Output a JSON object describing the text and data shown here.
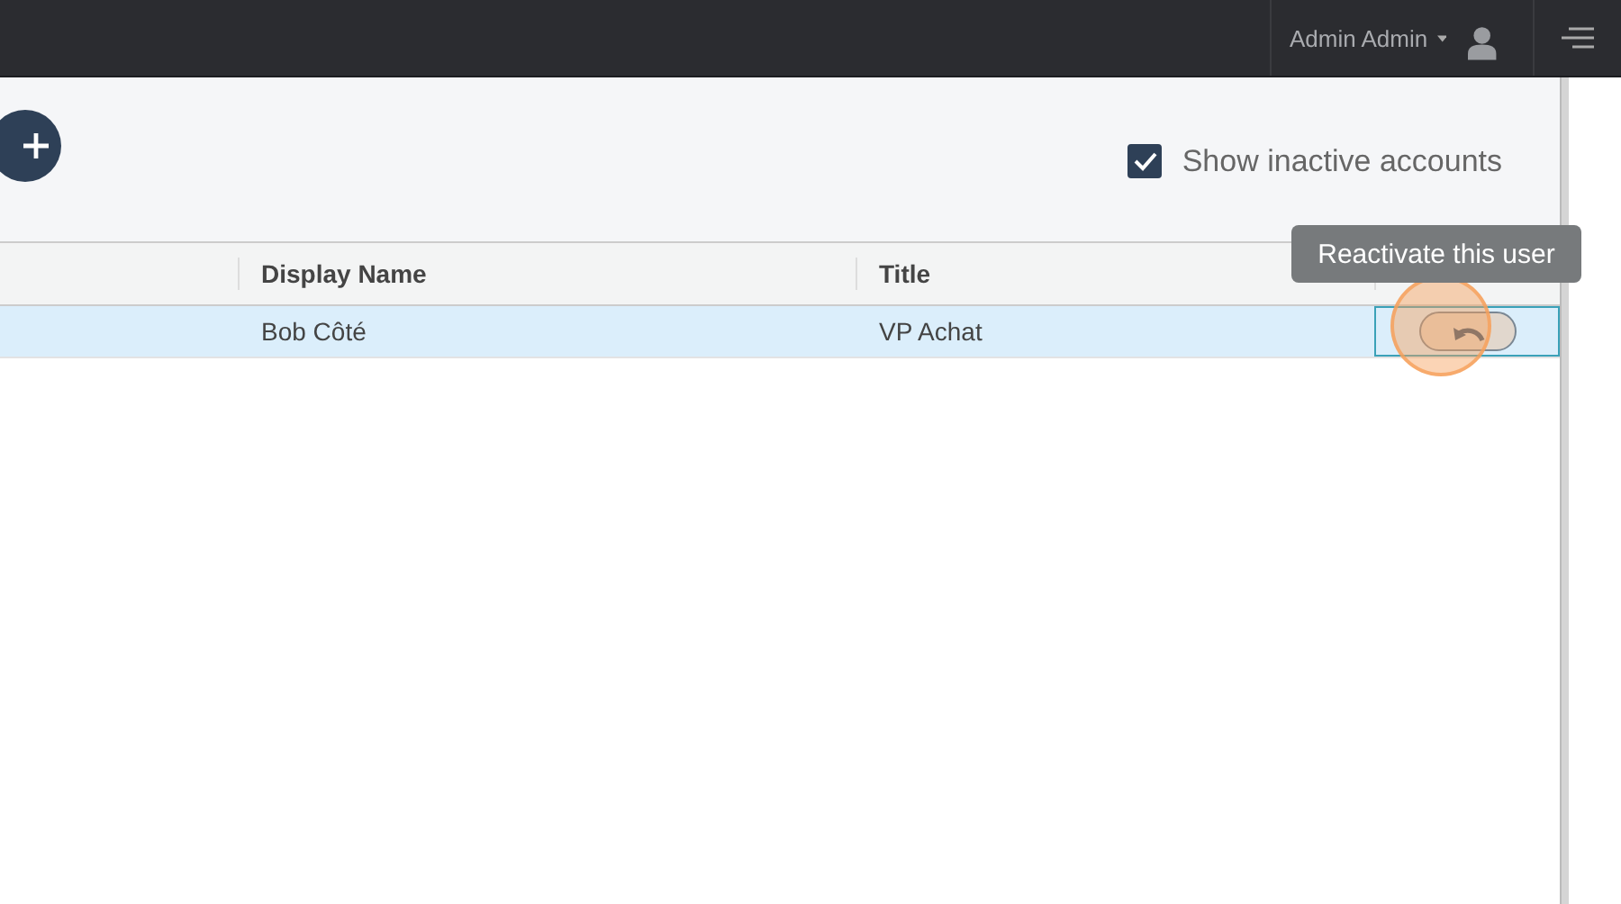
{
  "topbar": {
    "user_name": "Admin Admin"
  },
  "toolbar": {
    "show_inactive": {
      "label": "Show inactive accounts",
      "checked": true
    }
  },
  "table": {
    "columns": [
      {
        "label": "Display Name"
      },
      {
        "label": "Title"
      }
    ],
    "rows": [
      {
        "selected": true,
        "cells": [
          "Bob Côté",
          "VP Achat"
        ]
      }
    ]
  },
  "tooltip": {
    "text": "Reactivate this user"
  }
}
